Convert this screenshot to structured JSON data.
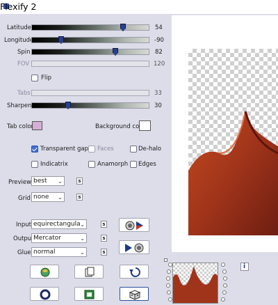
{
  "window": {
    "title": "Flexify 2"
  },
  "sliders": [
    {
      "label": "Latitude",
      "value": "54",
      "fraction": 0.8,
      "enabled": true
    },
    {
      "label": "Longitude",
      "value": "-90",
      "fraction": 0.25,
      "enabled": true
    },
    {
      "label": "Spin",
      "value": "82",
      "fraction": 0.73,
      "enabled": true
    },
    {
      "label": "FOV",
      "value": "120",
      "fraction": 0.0,
      "enabled": false
    }
  ],
  "flip": {
    "label": "Flip",
    "checked": false
  },
  "tabs_slider": {
    "label": "Tabs",
    "value": "33",
    "enabled": false
  },
  "sharpen_slider": {
    "label": "Sharpen",
    "value": "30",
    "fraction": 0.31,
    "enabled": true
  },
  "colors": {
    "tab_color_label": "Tab color",
    "tab_color": "#d6aed8",
    "background_color_label": "Background color",
    "background_color": "#ffffff"
  },
  "options": {
    "transparent_gaps": {
      "label": "Transparent gaps",
      "checked": true
    },
    "faces": {
      "label": "Faces",
      "checked": false
    },
    "de_halo": {
      "label": "De-halo",
      "checked": false
    },
    "indicatrix": {
      "label": "Indicatrix",
      "checked": false
    },
    "anamorph": {
      "label": "Anamorph",
      "checked": false
    },
    "edges": {
      "label": "Edges",
      "checked": false
    }
  },
  "preview_select": {
    "label": "Preview",
    "value": "best"
  },
  "grid_select": {
    "label": "Grid",
    "value": "none"
  },
  "input_select": {
    "label": "Input",
    "value": "equirectangula"
  },
  "output_select": {
    "label": "Output",
    "value": "Mercator"
  },
  "glue_select": {
    "label": "Glue",
    "value": "normal"
  },
  "small_button_label": "s",
  "info_label": "i",
  "icons": [
    "globe-icon",
    "pages-icon",
    "undo-icon",
    "ring-icon",
    "square-icon",
    "dice-icon",
    "play-globe-icon"
  ]
}
